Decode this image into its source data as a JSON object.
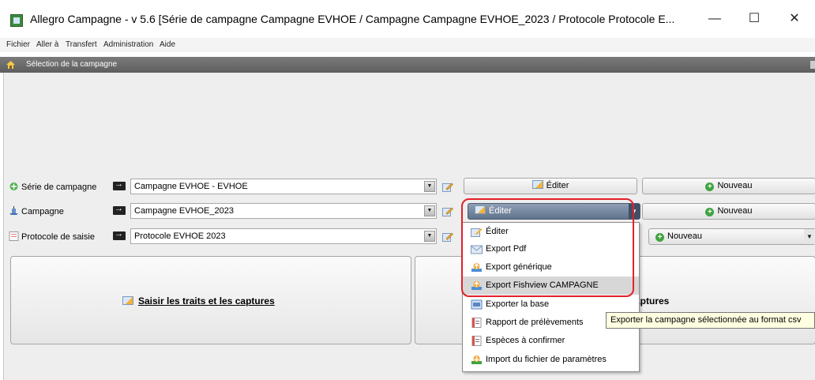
{
  "window": {
    "title": "Allegro Campagne - v 5.6 [Série de campagne Campagne EVHOE / Campagne Campagne EVHOE_2023 / Protocole Protocole E...",
    "minimize": "—",
    "maximize": "☐",
    "close": "✕"
  },
  "menu": {
    "fichier": "Fichier",
    "aller": "Aller à",
    "transfert": "Transfert",
    "administration": "Administration",
    "aide": "Aide"
  },
  "header": {
    "title": "Sélection de la campagne"
  },
  "rows": {
    "serie": {
      "label": "Série de campagne",
      "value": "Campagne EVHOE - EVHOE",
      "edit": "Éditer",
      "new": "Nouveau"
    },
    "campagne": {
      "label": "Campagne",
      "value": "Campagne EVHOE_2023",
      "edit": "Éditer",
      "new": "Nouveau"
    },
    "protocole": {
      "label": "Protocole de saisie",
      "value": "Protocole EVHOE 2023",
      "new": "Nouveau"
    }
  },
  "big_buttons": {
    "saisir": "Saisir les traits et les captures",
    "right_partial": "aptures"
  },
  "popup_menu": {
    "items": [
      {
        "label": "Éditer",
        "icon": "edit-icon"
      },
      {
        "label": "Export Pdf",
        "icon": "email-icon"
      },
      {
        "label": "Export générique",
        "icon": "export-icon"
      },
      {
        "label": "Export Fishview CAMPAGNE",
        "icon": "export-icon",
        "highlighted": true
      },
      {
        "label": "Exporter la base",
        "icon": "database-icon"
      },
      {
        "label": "Rapport de prélèvements",
        "icon": "report-icon"
      },
      {
        "label": "Espèces à confirmer",
        "icon": "report-icon"
      },
      {
        "label": "Import du fichier de paramètres",
        "icon": "import-icon"
      }
    ]
  },
  "tooltip": {
    "text": "Exporter la campagne sélectionnée au format csv"
  },
  "colors": {
    "highlight": "#e4202a",
    "header_bg": "#6b6b6b",
    "menu_hover": "#d7d7d7"
  }
}
